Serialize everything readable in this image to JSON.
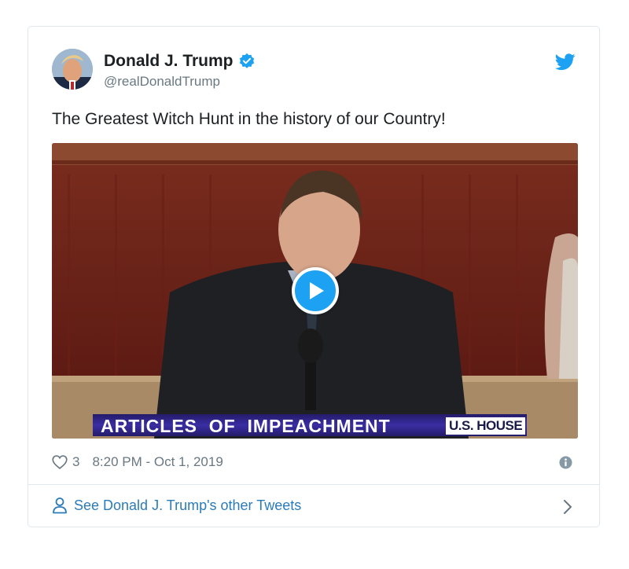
{
  "tweet": {
    "author": {
      "name": "Donald J. Trump",
      "handle": "@realDonaldTrump",
      "verified": true,
      "avatar_icon": "profile-photo"
    },
    "text": "The Greatest Witch Hunt in the history of our Country!",
    "media": {
      "type": "video",
      "caption_overlay": "ARTICLES  OF  IMPEACHMENT",
      "channel_tag": "U.S. HOUSE",
      "play_icon": "play-icon"
    },
    "likes": "3",
    "timestamp": "8:20 PM - Oct 1, 2019"
  },
  "footer": {
    "link_label": "See Donald J. Trump's other Tweets"
  },
  "colors": {
    "twitter_blue": "#1da1f2",
    "link": "#2b7bb9",
    "muted": "#697882",
    "text": "#1c2022",
    "border": "#e1e8ed"
  }
}
